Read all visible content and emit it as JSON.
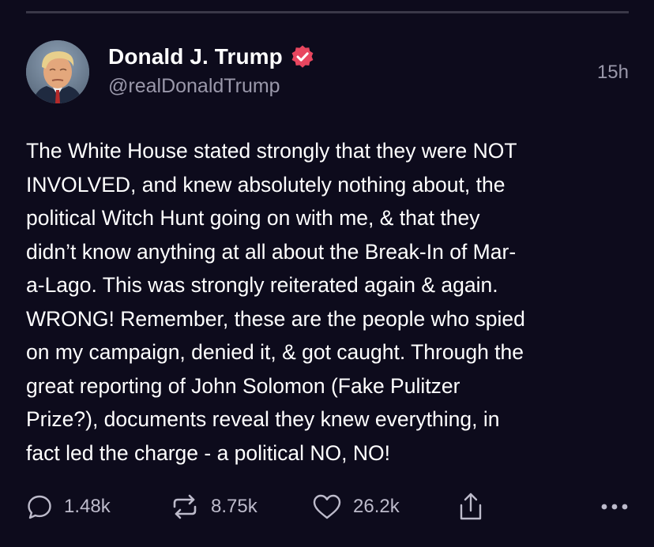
{
  "post": {
    "author": {
      "display_name": "Donald J. Trump",
      "handle": "@realDonaldTrump",
      "verified": true
    },
    "timestamp": "15h",
    "text": "The White House stated strongly that they were NOT\nINVOLVED, and knew absolutely nothing about, the\npolitical Witch Hunt going on with me, & that they\ndidn’t know anything at all about the Break-In of Mar-\na-Lago. This was strongly reiterated again & again.\nWRONG! Remember, these are the people who spied\non my campaign, denied it, & got caught. Through the\ngreat reporting of John Solomon (Fake Pulitzer\nPrize?), documents reveal they knew everything, in\nfact led the charge - a political NO, NO!"
  },
  "actions": {
    "reply_count": "1.48k",
    "repost_count": "8.75k",
    "like_count": "26.2k"
  },
  "icons": {
    "reply": "speech-bubble-icon",
    "repost": "repost-arrows-icon",
    "like": "heart-icon",
    "share": "share-upload-icon",
    "more": "ellipsis-icon",
    "verified": "verified-badge-icon"
  },
  "colors": {
    "background": "#0d0b1c",
    "verified_badge": "#e8465f",
    "secondary_text": "#9a98aa",
    "action_icons": "#bdbbcb"
  }
}
